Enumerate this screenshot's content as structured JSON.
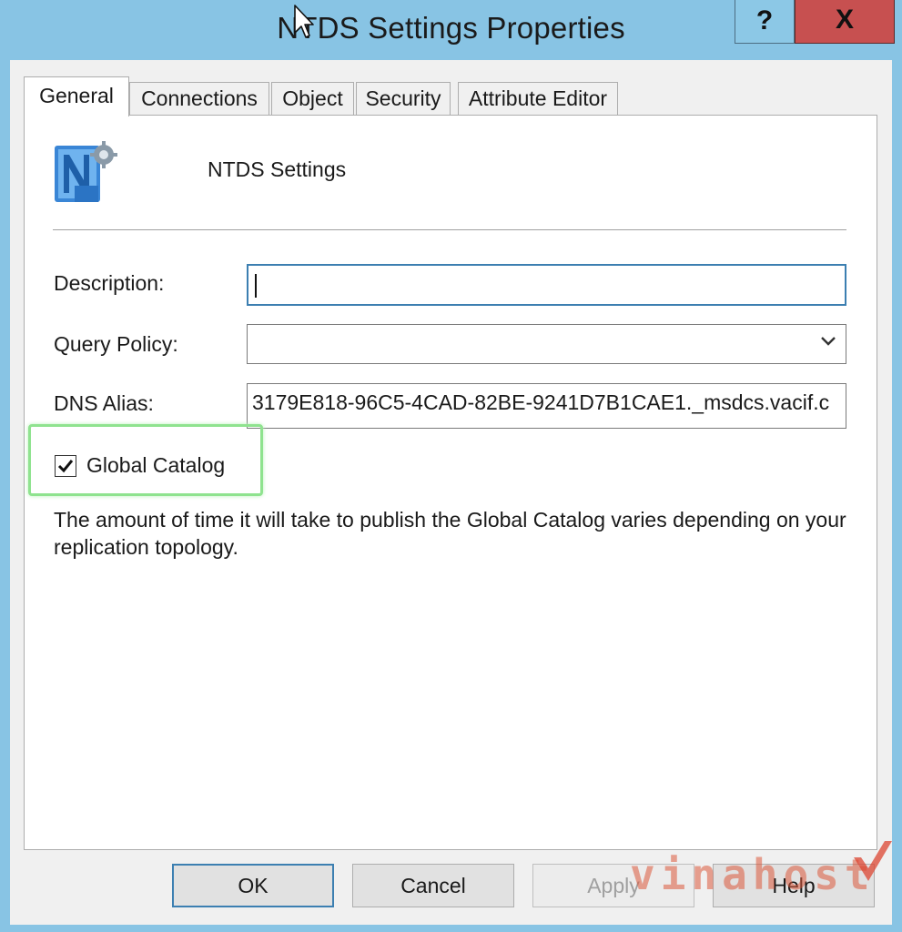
{
  "window": {
    "title": "NTDS Settings Properties",
    "help_button": "?",
    "close_button": "X"
  },
  "tabs": [
    {
      "label": "General",
      "active": true
    },
    {
      "label": "Connections",
      "active": false
    },
    {
      "label": "Object",
      "active": false
    },
    {
      "label": "Security",
      "active": false
    },
    {
      "label": "Attribute Editor",
      "active": false
    }
  ],
  "object": {
    "icon": "ntds-settings-icon",
    "name": "NTDS Settings"
  },
  "form": {
    "description": {
      "label": "Description:",
      "value": ""
    },
    "query_policy": {
      "label": "Query Policy:",
      "value": ""
    },
    "dns_alias": {
      "label": "DNS Alias:",
      "value": "3179E818-96C5-4CAD-82BE-9241D7B1CAE1._msdcs.vacif.c"
    },
    "global_catalog": {
      "label": "Global Catalog",
      "checked": true,
      "highlight_color": "#8fe38f"
    },
    "info_text": "The amount of time it will take to publish the Global Catalog varies depending on your replication topology."
  },
  "buttons": {
    "ok": "OK",
    "cancel": "Cancel",
    "apply": "Apply",
    "help": "Help"
  },
  "watermark": {
    "text": "vinahost"
  },
  "colors": {
    "frame": "#88c4e4",
    "close": "#c75050",
    "focus": "#3c7fb1"
  }
}
